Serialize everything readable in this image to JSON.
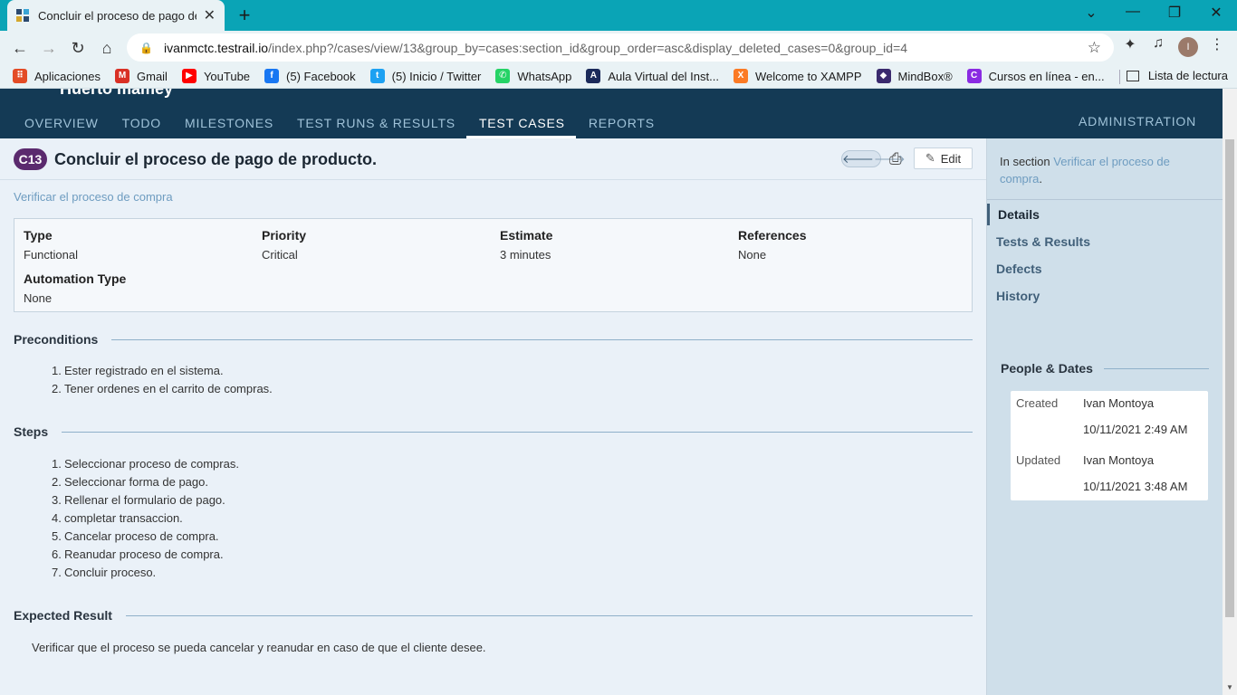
{
  "browser": {
    "tab_title": "Concluir el proceso de pago de p",
    "new_tab": "+",
    "url_host": "ivanmctc.testrail.io",
    "url_path": "/index.php?/cases/view/13&group_by=cases:section_id&group_order=asc&display_deleted_cases=0&group_id=4",
    "avatar_letter": "I",
    "bookmarks": [
      {
        "label": "Aplicaciones",
        "icon": "apps-grid-icon",
        "color": "#e34c26"
      },
      {
        "label": "Gmail",
        "icon": "gmail-icon",
        "color": "#d93025"
      },
      {
        "label": "YouTube",
        "icon": "youtube-icon",
        "color": "#ff0000"
      },
      {
        "label": "(5) Facebook",
        "icon": "facebook-icon",
        "color": "#1877f2"
      },
      {
        "label": "(5) Inicio / Twitter",
        "icon": "twitter-icon",
        "color": "#1da1f2"
      },
      {
        "label": "WhatsApp",
        "icon": "whatsapp-icon",
        "color": "#25d366"
      },
      {
        "label": "Aula Virtual del Inst...",
        "icon": "aula-icon",
        "color": "#1b2a5a"
      },
      {
        "label": "Welcome to XAMPP",
        "icon": "xampp-icon",
        "color": "#fb7a24"
      },
      {
        "label": "MindBox®",
        "icon": "mindbox-icon",
        "color": "#3a2a6e"
      },
      {
        "label": "Cursos en línea - en...",
        "icon": "cursos-icon",
        "color": "#8a2be2"
      }
    ],
    "reading_list": "Lista de lectura"
  },
  "app": {
    "project_name": "Huerto mamey",
    "nav": [
      "OVERVIEW",
      "TODO",
      "MILESTONES",
      "TEST RUNS & RESULTS",
      "TEST CASES",
      "REPORTS"
    ],
    "active_nav": "TEST CASES",
    "admin": "ADMINISTRATION"
  },
  "case": {
    "badge": "C13",
    "title": "Concluir el proceso de pago de producto.",
    "edit_label": "Edit",
    "section_link": "Verificar el proceso de compra",
    "props": {
      "type_label": "Type",
      "type_value": "Functional",
      "priority_label": "Priority",
      "priority_value": "Critical",
      "estimate_label": "Estimate",
      "estimate_value": "3 minutes",
      "references_label": "References",
      "references_value": "None",
      "automation_label": "Automation Type",
      "automation_value": "None"
    },
    "preconditions_heading": "Preconditions",
    "preconditions": [
      "Ester registrado en el sistema.",
      "Tener ordenes en el carrito de compras."
    ],
    "steps_heading": "Steps",
    "steps": [
      "Seleccionar proceso de compras.",
      "Seleccionar forma de pago.",
      "Rellenar el formulario de pago.",
      "completar transaccion.",
      "Cancelar proceso de compra.",
      "Reanudar proceso de compra.",
      "Concluir proceso."
    ],
    "expected_heading": "Expected Result",
    "expected": "Verificar que el proceso se pueda cancelar y reanudar en caso de que el cliente desee."
  },
  "sidebar": {
    "in_section_prefix": "In section ",
    "in_section_link": "Verificar el proceso de compra",
    "in_section_suffix": ".",
    "items": [
      "Details",
      "Tests & Results",
      "Defects",
      "History"
    ],
    "people_heading": "People & Dates",
    "created_label": "Created",
    "created_by": "Ivan Montoya",
    "created_at": "10/11/2021 2:49 AM",
    "updated_label": "Updated",
    "updated_by": "Ivan Montoya",
    "updated_at": "10/11/2021 3:48 AM"
  },
  "colors": {
    "tabstrip": "#0aa4b6",
    "app_header": "#143a55",
    "badge": "#5b2a6e",
    "link": "#6e9cc0"
  }
}
